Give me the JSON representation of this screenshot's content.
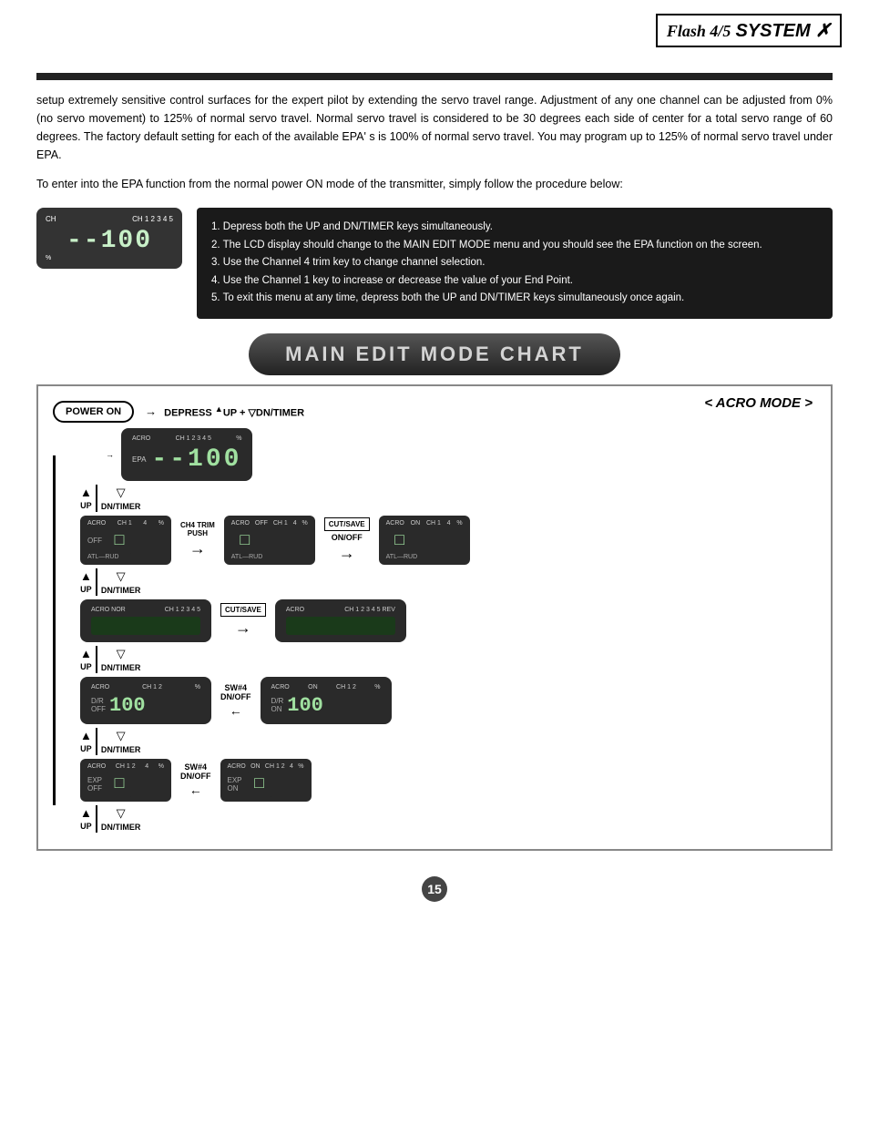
{
  "header": {
    "logo_text": "Flash 4/5",
    "system_text": "SYSTEM"
  },
  "body_paragraphs": [
    "setup extremely sensitive control surfaces for the expert pilot by extending the servo travel range.   Adjustment of any one channel can be adjusted from 0% (no servo movement) to 125% of normal servo travel.  Normal servo travel is considered to be 30 degrees each side of center for a total servo range of 60 degrees.  The factory default setting for each of the available EPA' s is 100% of normal servo travel.  You may program up to 125% of normal servo travel under EPA.",
    "To enter into the EPA function from the normal power ON mode of the transmitter, simply follow the procedure below:"
  ],
  "procedure_steps": [
    "1.  Depress both the UP and DN/TIMER keys simultaneously.",
    "2.  The LCD display should change to the MAIN EDIT MODE menu and you should see the EPA function on the screen.",
    "3.  Use the Channel 4 trim key to change channel selection.",
    "4.  Use the Channel 1 key to increase or decrease the value of your End Point.",
    "5.  To exit this menu at any time, depress both the UP and DN/TIMER keys simultaneously once again."
  ],
  "chart": {
    "title": "MAIN EDIT MODE CHART",
    "acro_mode_label": "< ACRO MODE >",
    "power_on": "POWER ON",
    "depress_label": "DEPRESS",
    "up_key": "UP",
    "dn_timer_key": "DN/TIMER",
    "epa_label": "EPA",
    "ch4_trim_push": "CH4 TRIM\nPUSH",
    "cut_save_label": "CUT/SAVE",
    "on_off_label": "ON/OFF",
    "sw4_label": "SW#4\nDN/OFF",
    "up_label": "UP",
    "dn_timer_label": "DN/TIMER"
  },
  "lcd_displays": {
    "epa": {
      "top_left": "ACRO",
      "top_right": "CH 1 2 3 4 5",
      "label": "EPA",
      "digits": "--100",
      "footer": ""
    },
    "off_ch1": {
      "top_left": "ACRO",
      "top_right": "CH 1",
      "label": "OFF",
      "digits": "□",
      "footer": "ATL—RUD"
    },
    "off_ch1_b": {
      "top_left": "ACRO",
      "top_right": "CH 1",
      "label": "OFF",
      "digits": "□",
      "footer": "ATL—RUD"
    },
    "on_ch1": {
      "top_left": "ACRO",
      "top_right": "CH 1",
      "label": "ON",
      "digits": "□",
      "footer": "ATL—RUD"
    },
    "nor_ch": {
      "top_left": "ACRO NOR",
      "top_right": "CH 1 2 3 4 5",
      "digits": ""
    },
    "rev_ch": {
      "top_left": "ACRO",
      "top_right": "CH 1 2 3 4 5 REV",
      "digits": ""
    },
    "dr_off": {
      "top_left": "ACRO",
      "top_right": "CH 1 2",
      "label": "D/R OFF",
      "digits": "100",
      "suffix": "%"
    },
    "dr_on": {
      "top_left": "ACRO",
      "top_right": "CH 1 2",
      "label": "D/R ON",
      "digits": "100",
      "suffix": "%"
    },
    "exp_off": {
      "top_left": "ACRO",
      "top_right": "CH 1 2 4",
      "label": "EXP OFF",
      "digits": "□"
    },
    "exp_on": {
      "top_left": "ACRO",
      "top_right": "CH 1 2 4",
      "label": "EXP ON",
      "digits": "□"
    }
  },
  "page_number": "15"
}
